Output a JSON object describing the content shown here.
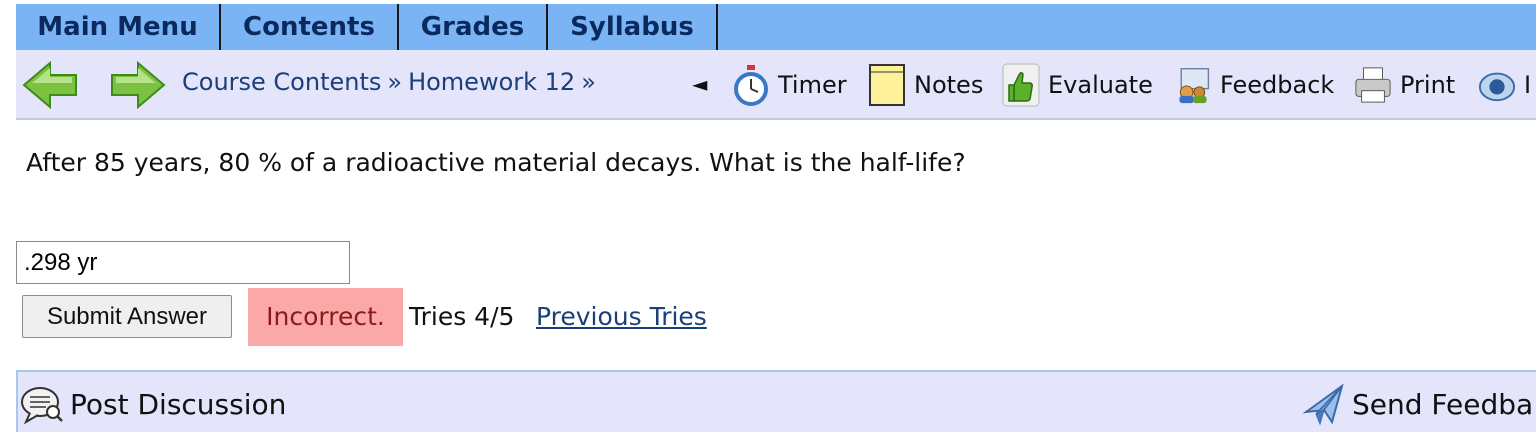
{
  "topnav": {
    "items": [
      {
        "label": "Main Menu"
      },
      {
        "label": "Contents"
      },
      {
        "label": "Grades"
      },
      {
        "label": "Syllabus"
      }
    ]
  },
  "toolbar": {
    "back_icon": "green-left-arrow-icon",
    "forward_icon": "green-right-arrow-icon",
    "breadcrumbs": [
      "Course Contents",
      "Homework 12"
    ],
    "separator": "»",
    "collapse_glyph": "◄",
    "tools": [
      {
        "label": "Timer",
        "icon": "stopwatch-icon"
      },
      {
        "label": "Notes",
        "icon": "note-icon"
      },
      {
        "label": "Evaluate",
        "icon": "thumbs-up-icon"
      },
      {
        "label": "Feedback",
        "icon": "feedback-icon"
      },
      {
        "label": "Print",
        "icon": "printer-icon"
      },
      {
        "label": "I",
        "icon": "info-icon"
      }
    ]
  },
  "question": {
    "text": "After 85 years, 80 % of a radioactive material decays. What is the half-life?",
    "answer_value": ".298 yr",
    "submit_label": "Submit Answer",
    "status": "Incorrect.",
    "tries": "Tries 4/5",
    "previous_tries_label": "Previous Tries"
  },
  "bottom": {
    "post_discussion": "Post Discussion",
    "send_feedback": "Send Feedba"
  },
  "colors": {
    "nav_bg": "#7ab4f5",
    "toolbar_bg": "#e4e4fb",
    "incorrect_bg": "#fba8a8",
    "link": "#1a3f7a"
  }
}
